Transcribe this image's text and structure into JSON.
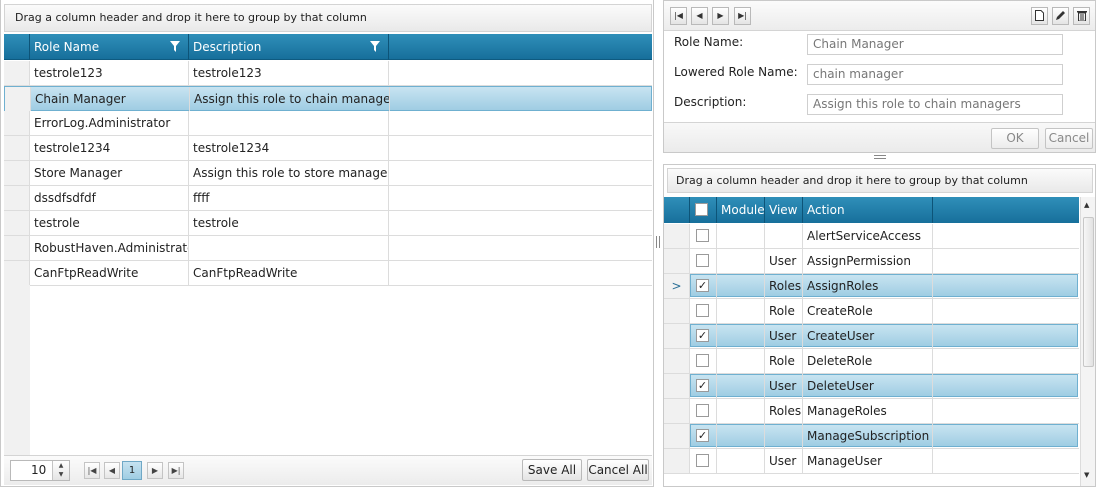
{
  "roles_grid": {
    "group_hint": "Drag a column header and drop it here to group by that column",
    "columns": [
      "Role Name",
      "Description"
    ],
    "rows": [
      {
        "name": "testrole123",
        "description": "testrole123"
      },
      {
        "name": "Chain Manager",
        "description": "Assign this role to chain managers",
        "selected": true
      },
      {
        "name": "ErrorLog.Administrator",
        "description": ""
      },
      {
        "name": "testrole1234",
        "description": "testrole1234"
      },
      {
        "name": "Store Manager",
        "description": "Assign this role to store managers"
      },
      {
        "name": "dssdfsdfdf",
        "description": "ffff"
      },
      {
        "name": "testrole",
        "description": "testrole"
      },
      {
        "name": "RobustHaven.Administrator",
        "description": ""
      },
      {
        "name": "CanFtpReadWrite",
        "description": "CanFtpReadWrite"
      }
    ],
    "pager": {
      "page_size": "10",
      "current_page": "1",
      "save_all": "Save All",
      "cancel_all": "Cancel All"
    }
  },
  "role_form": {
    "fields": [
      {
        "label": "Role Name:",
        "value": "Chain Manager"
      },
      {
        "label": "Lowered Role Name:",
        "value": "chain manager"
      },
      {
        "label": "Description:",
        "value": "Assign this role to chain managers"
      }
    ],
    "ok_label": "OK",
    "cancel_label": "Cancel"
  },
  "permissions_grid": {
    "group_hint": "Drag a column header and drop it here to group by that column",
    "columns": [
      "Module",
      "View",
      "Action"
    ],
    "rows": [
      {
        "checked": false,
        "module": "",
        "view": "",
        "action": "AlertServiceAccess"
      },
      {
        "checked": false,
        "module": "",
        "view": "User",
        "action": "AssignPermission"
      },
      {
        "checked": true,
        "module": "",
        "view": "Roles",
        "action": "AssignRoles",
        "current": true
      },
      {
        "checked": false,
        "module": "",
        "view": "Role",
        "action": "CreateRole"
      },
      {
        "checked": true,
        "module": "",
        "view": "User",
        "action": "CreateUser"
      },
      {
        "checked": false,
        "module": "",
        "view": "Role",
        "action": "DeleteRole"
      },
      {
        "checked": true,
        "module": "",
        "view": "User",
        "action": "DeleteUser"
      },
      {
        "checked": false,
        "module": "",
        "view": "Roles",
        "action": "ManageRoles"
      },
      {
        "checked": true,
        "module": "",
        "view": "",
        "action": "ManageSubscription"
      },
      {
        "checked": false,
        "module": "",
        "view": "User",
        "action": "ManageUser"
      }
    ],
    "current_row_marker": ">"
  },
  "icons": {
    "filter": "filter-icon",
    "first": "first-page-icon",
    "prev": "previous-page-icon",
    "next": "next-page-icon",
    "last": "last-page-icon",
    "new": "new-document-icon",
    "edit": "pencil-icon",
    "delete": "trash-icon"
  },
  "colors": {
    "header": "#1f7ea9",
    "selection": "#b3d9eb"
  }
}
